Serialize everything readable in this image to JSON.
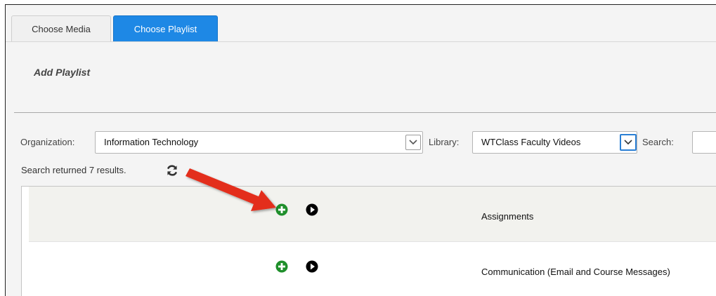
{
  "tabs": [
    {
      "label": "Choose Media",
      "active": false
    },
    {
      "label": "Choose Playlist",
      "active": true
    }
  ],
  "add_playlist_label": "Add Playlist",
  "filters": {
    "organization_label": "Organization:",
    "organization_value": "Information Technology",
    "library_label": "Library:",
    "library_value": "WTClass Faculty Videos",
    "search_label": "Search:",
    "search_value": ""
  },
  "status_text": "Search returned 7 results.",
  "results": [
    {
      "title": "Assignments",
      "highlighted": true
    },
    {
      "title": "Communication (Email and Course Messages)",
      "highlighted": false
    }
  ],
  "colors": {
    "tab_active": "#1e88e5",
    "add_icon": "#1f8f2b",
    "annotation_arrow": "#e32d1b"
  },
  "icons": [
    "refresh-icon",
    "add-to-playlist-icon",
    "play-icon",
    "chevron-down-icon",
    "annotation-arrow"
  ]
}
